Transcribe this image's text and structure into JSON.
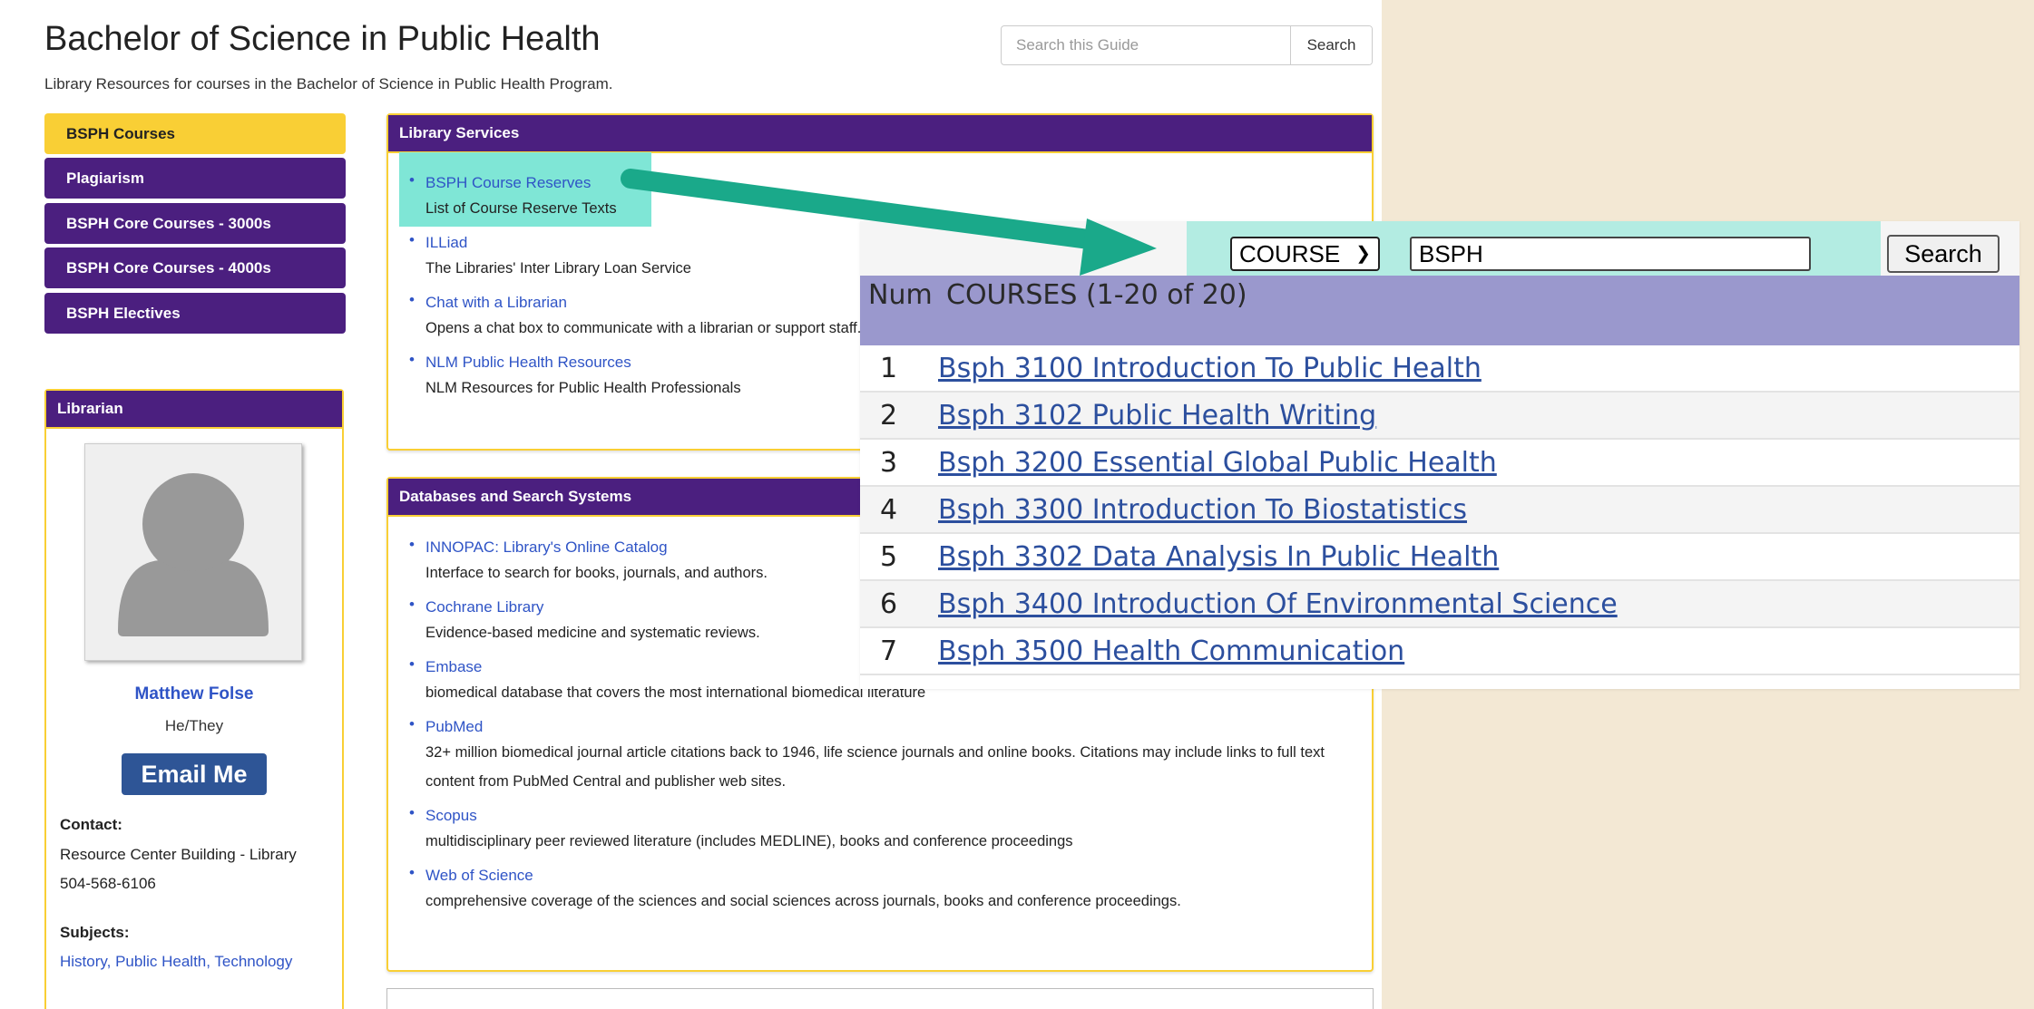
{
  "guide": {
    "title": "Bachelor of Science in Public Health",
    "description": "Library Resources for courses in the Bachelor of Science in Public Health Program.",
    "search_placeholder": "Search this Guide",
    "search_button": "Search"
  },
  "nav": {
    "items": [
      {
        "label": "BSPH Courses",
        "active": true
      },
      {
        "label": "Plagiarism"
      },
      {
        "label": "BSPH Core Courses - 3000s"
      },
      {
        "label": "BSPH Core Courses - 4000s"
      },
      {
        "label": "BSPH Electives"
      }
    ]
  },
  "librarian": {
    "header": "Librarian",
    "name": "Matthew Folse",
    "pronouns": "He/They",
    "email_button": "Email Me",
    "contact_label": "Contact:",
    "contact_address": "Resource Center Building - Library",
    "contact_phone": "504-568-6106",
    "subjects_label": "Subjects:",
    "subjects": "History, Public Health, Technology"
  },
  "library_services": {
    "header": "Library Services",
    "items": [
      {
        "link": "BSPH Course Reserves",
        "desc": "List of Course Reserve Texts"
      },
      {
        "link": "ILLiad",
        "desc": "The Libraries' Inter Library Loan Service"
      },
      {
        "link": "Chat with a Librarian",
        "desc": "Opens a chat box to communicate with a librarian or support staff."
      },
      {
        "link": "NLM Public Health Resources",
        "desc": "NLM Resources for Public Health Professionals"
      }
    ]
  },
  "databases": {
    "header": "Databases and Search Systems",
    "items": [
      {
        "link": "INNOPAC: Library's Online Catalog",
        "desc": "Interface to search for books, journals, and authors."
      },
      {
        "link": "Cochrane Library",
        "desc": "Evidence-based medicine and systematic reviews."
      },
      {
        "link": "Embase",
        "desc": "biomedical database that covers the most international biomedical literature"
      },
      {
        "link": "PubMed",
        "desc": "32+ million biomedical journal article citations back to 1946, life science journals and online books. Citations may include links to full text content from PubMed Central and publisher web sites."
      },
      {
        "link": "Scopus",
        "desc": "multidisciplinary peer reviewed literature (includes MEDLINE), books and conference proceedings"
      },
      {
        "link": "Web of Science",
        "desc": "comprehensive coverage of the sciences and social sciences across journals, books and conference proceedings."
      }
    ]
  },
  "overlay": {
    "select_value": "COURSE",
    "query": "BSPH",
    "search_button": "Search",
    "num_header": "Num",
    "title_header": "COURSES (1-20 of 20)",
    "rows": [
      {
        "num": "1",
        "title": "Bsph 3100 Introduction To Public Health"
      },
      {
        "num": "2",
        "title": "Bsph 3102 Public Health Writing"
      },
      {
        "num": "3",
        "title": "Bsph 3200 Essential Global Public Health"
      },
      {
        "num": "4",
        "title": "Bsph 3300 Introduction To Biostatistics"
      },
      {
        "num": "5",
        "title": "Bsph 3302 Data Analysis In Public Health"
      },
      {
        "num": "6",
        "title": "Bsph 3400 Introduction Of Environmental Science"
      },
      {
        "num": "7",
        "title": "Bsph 3500 Health Communication"
      }
    ]
  },
  "colors": {
    "purple": "#4b1f7f",
    "gold": "#f9cf35",
    "link": "#2f54c6",
    "teal_highlight": "#7fe6d6",
    "arrow": "#1aa98a",
    "overlay_header": "#9a98cd",
    "background": "#f3e8d4"
  }
}
